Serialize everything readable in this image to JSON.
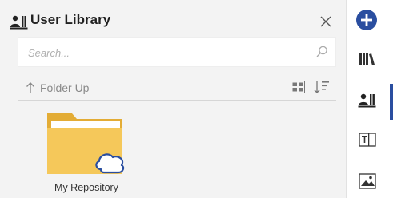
{
  "panel": {
    "title": "User Library",
    "search": {
      "placeholder": "Search..."
    },
    "toolbar": {
      "folder_up_label": "Folder Up"
    },
    "items": [
      {
        "label": "My Repository"
      }
    ]
  },
  "icons": {
    "title": "user-library-icon",
    "close": "close-icon",
    "search": "search-icon",
    "folder_up": "arrow-up-icon",
    "view": "grid-view-icon",
    "sort": "sort-icon",
    "folder": "folder-cloud-icon"
  },
  "sidebar": {
    "items": [
      {
        "name": "add-button",
        "icon": "plus-circle-icon"
      },
      {
        "name": "libraries",
        "icon": "library-icon"
      },
      {
        "name": "user-library",
        "icon": "user-library-icon",
        "active": true
      },
      {
        "name": "text",
        "icon": "text-frame-icon"
      },
      {
        "name": "images",
        "icon": "image-icon"
      }
    ]
  },
  "colors": {
    "accent": "#2a4ea0",
    "panel_bg": "#f3f3f3",
    "folder": "#f5c85a",
    "folder_dark": "#e3ac35"
  }
}
